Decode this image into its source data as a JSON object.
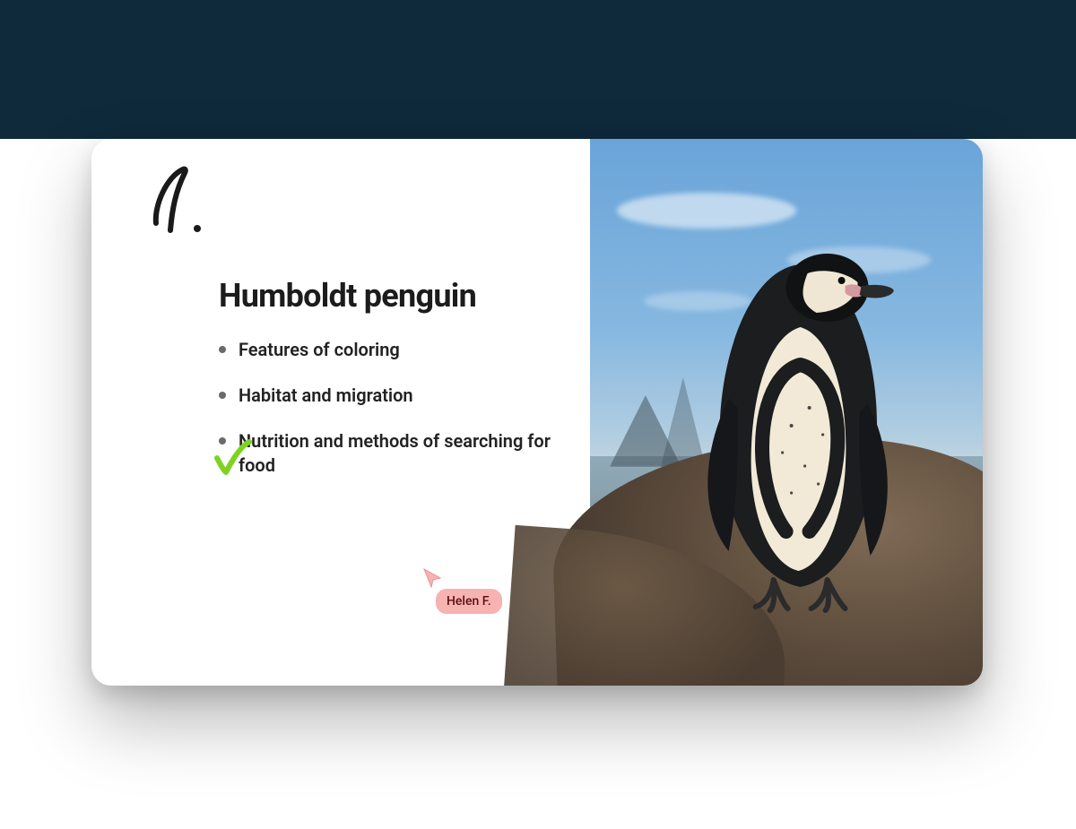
{
  "slide": {
    "number_annotation": "1.",
    "title": "Humboldt penguin",
    "bullets": [
      "Features of coloring",
      "Habitat and migration",
      "Nutrition and methods of searching for food"
    ],
    "checked_bullet_index": 1,
    "image_subject": "Humboldt penguin on a rock"
  },
  "collaborator_cursor": {
    "name": "Helen F.",
    "color": "#F7B2B2"
  }
}
